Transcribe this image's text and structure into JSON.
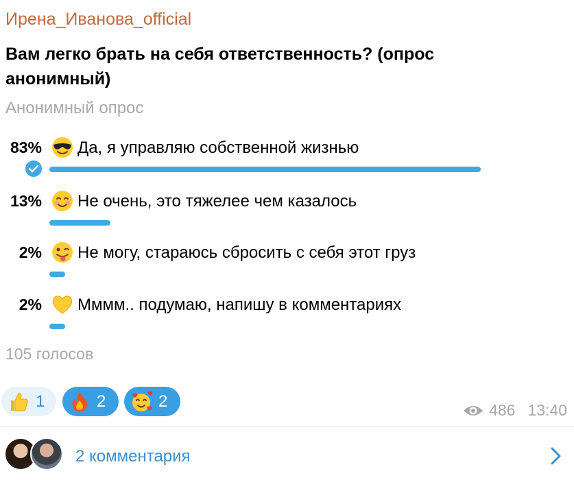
{
  "post": {
    "author": "Ирена_Иванова_official",
    "question": "Вам легко брать на себя ответственность? (опрос анонимный)",
    "poll_type": "Анонимный опрос",
    "options": [
      {
        "percent": "83%",
        "percent_value": 83,
        "emoji": "smiling-face-with-sunglasses-icon",
        "text": "Да, я управляю собственной жизнью",
        "chosen": true
      },
      {
        "percent": "13%",
        "percent_value": 13,
        "emoji": "smiling-face-icon",
        "text": "Не очень, это тяжелее чем казалось",
        "chosen": false
      },
      {
        "percent": "2%",
        "percent_value": 2,
        "emoji": "winking-face-with-tongue-icon",
        "text": "Не могу, стараюсь сбросить с себя этот груз",
        "chosen": false
      },
      {
        "percent": "2%",
        "percent_value": 2,
        "emoji": "yellow-heart-icon",
        "text": "Мммм.. подумаю, напишу в комментариях",
        "chosen": false
      }
    ],
    "votes": "105 голосов"
  },
  "reactions": [
    {
      "emoji": "thumbs-up-icon",
      "count": "1",
      "active": false
    },
    {
      "emoji": "fire-icon",
      "count": "2",
      "active": true
    },
    {
      "emoji": "smiling-face-with-hearts-icon",
      "count": "2",
      "active": true
    }
  ],
  "meta": {
    "views": "486",
    "time": "13:40"
  },
  "comments": {
    "label": "2 комментария"
  },
  "colors": {
    "author": "#c6693b",
    "accent": "#3fa9e3",
    "link": "#3a8fcf",
    "muted": "#a8a8a8"
  }
}
